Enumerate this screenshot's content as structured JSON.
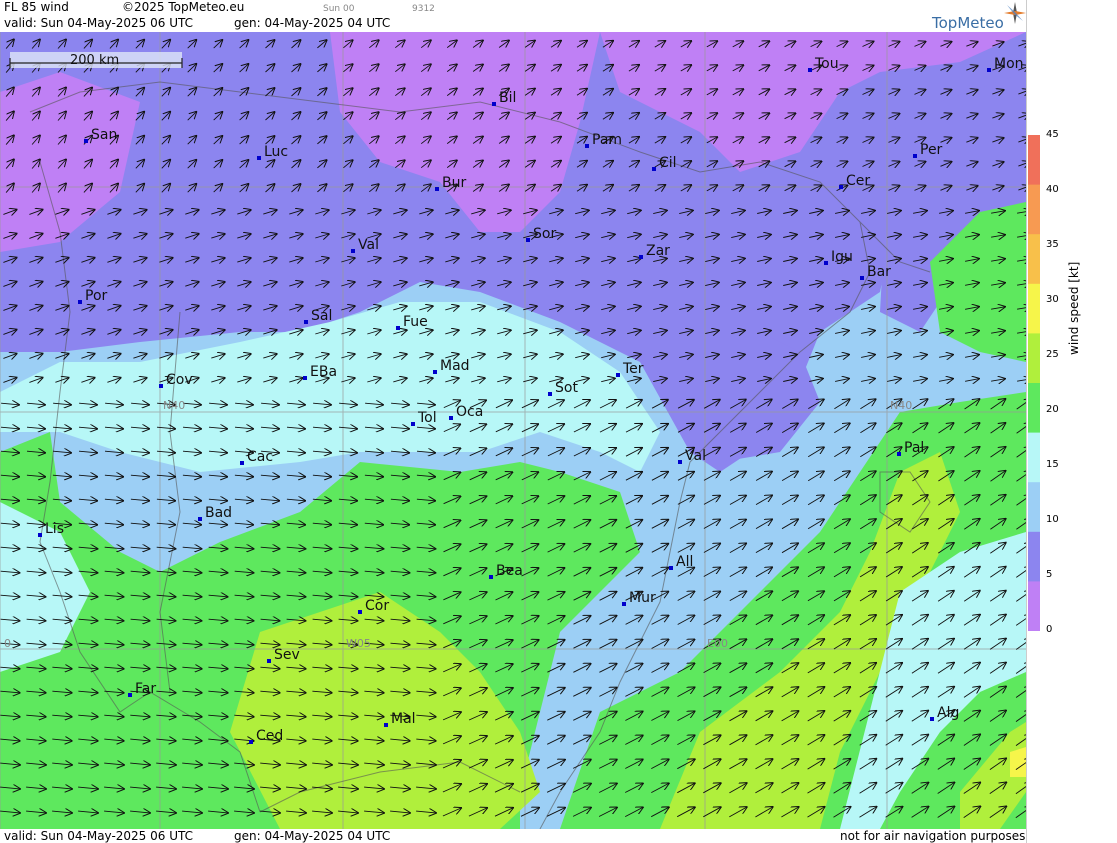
{
  "header": {
    "title": "FL 85 wind",
    "copyright": "©2025 TopMeteo.eu",
    "run": "Sun 00",
    "code": "9312",
    "valid": "valid:  Sun  04-May-2025  06 UTC",
    "gen": "gen: 04-May-2025 04 UTC",
    "logo": "TopMeteo"
  },
  "footer": {
    "valid": "valid:  Sun  04-May-2025  06 UTC",
    "gen": "gen: 04-May-2025 04 UTC",
    "disclaimer": "not for air navigation purposes"
  },
  "scale_bar": "200 km",
  "legend": {
    "title": "wind speed [kt]",
    "ticks": [
      "45",
      "40",
      "35",
      "30",
      "25",
      "20",
      "15",
      "10",
      "5",
      "0"
    ],
    "colors": [
      "#bf80f5",
      "#8c85ef",
      "#9ccff5",
      "#b7f7f7",
      "#5ee85e",
      "#b0ef3c",
      "#f6f54a",
      "#f8c04a",
      "#f79a52",
      "#f0705a"
    ]
  },
  "grid_labels": [
    "N40",
    "N40",
    "W05",
    "E00",
    "0"
  ],
  "cities": [
    "Tou",
    "Mon",
    "Bil",
    "San",
    "Luc",
    "Pam",
    "Cil",
    "Bur",
    "Per",
    "Cer",
    "Sor",
    "Val",
    "Zar",
    "Igu",
    "Bar",
    "Por",
    "Sal",
    "Fue",
    "EBa",
    "Mad",
    "Ter",
    "Cov",
    "Sot",
    "Tol",
    "Oca",
    "Pal",
    "Cac",
    "Val",
    "Bad",
    "Lis",
    "Bea",
    "All",
    "Cor",
    "Mur",
    "Sev",
    "Far",
    "Alg",
    "Mal",
    "Ced"
  ]
}
